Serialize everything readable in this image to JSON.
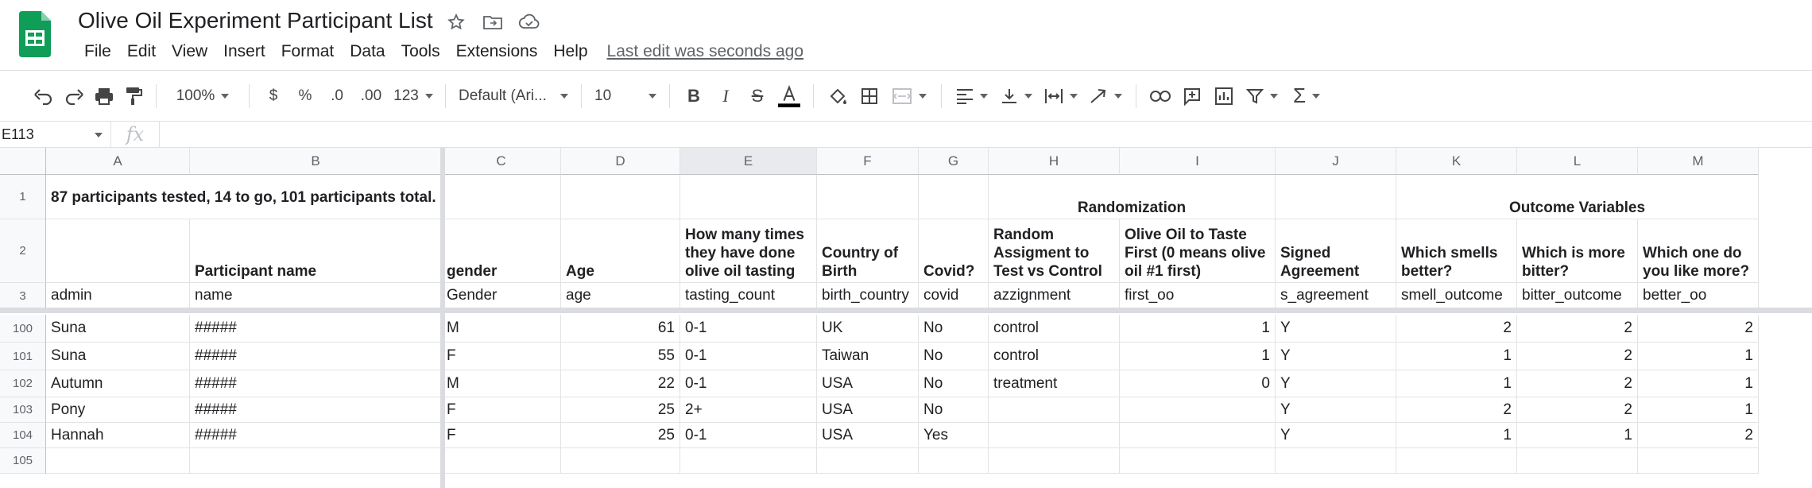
{
  "app": {
    "title": "Olive Oil Experiment Participant List",
    "menu": [
      "File",
      "Edit",
      "View",
      "Insert",
      "Format",
      "Data",
      "Tools",
      "Extensions",
      "Help"
    ],
    "last_edit": "Last edit was seconds ago"
  },
  "toolbar": {
    "zoom": "100%",
    "currency": "$",
    "percent": "%",
    "dec_decrease": ".0",
    "dec_increase": ".00",
    "more_formats": "123",
    "font": "Default (Ari...",
    "font_size": "10"
  },
  "formula_bar": {
    "cell_ref": "E113",
    "fx": "fx",
    "value": ""
  },
  "columns": [
    "A",
    "B",
    "C",
    "D",
    "E",
    "F",
    "G",
    "H",
    "I",
    "J",
    "K",
    "L",
    "M"
  ],
  "selected_column": "E",
  "row1": {
    "num": "1",
    "A": "87 participants tested, 14 to go, 101 participants total.",
    "H": "Randomization",
    "K": "Outcome Variables"
  },
  "row2": {
    "num": "2",
    "B": "Participant name",
    "C": "gender",
    "D": "Age",
    "E": "How many times they have done olive oil tasting",
    "F": "Country of Birth",
    "G": "Covid?",
    "H": "Random Assigment to Test vs Control",
    "I": "Olive Oil to Taste First (0 means olive oil #1 first)",
    "J": "Signed Agreement",
    "K": "Which smells better?",
    "L": "Which is more bitter?",
    "M": "Which one do you like more?"
  },
  "row3": {
    "num": "3",
    "A": "admin",
    "B": "name",
    "C": "Gender",
    "D": "age",
    "E": "tasting_count",
    "F": "birth_country",
    "G": "covid",
    "H": "azzignment",
    "I": "first_oo",
    "J": "s_agreement",
    "K": "smell_outcome",
    "L": "bitter_outcome",
    "M": "better_oo"
  },
  "data_rows": [
    {
      "num": "100",
      "A": "Suna",
      "B": "#####",
      "C": "M",
      "D": "61",
      "E": "0-1",
      "F": "UK",
      "G": "No",
      "H": "control",
      "I": "1",
      "J": "Y",
      "K": "2",
      "L": "2",
      "M": "2"
    },
    {
      "num": "101",
      "A": "Suna",
      "B": "#####",
      "C": "F",
      "D": "55",
      "E": "0-1",
      "F": "Taiwan",
      "G": "No",
      "H": "control",
      "I": "1",
      "J": "Y",
      "K": "1",
      "L": "2",
      "M": "1"
    },
    {
      "num": "102",
      "A": "Autumn",
      "B": "#####",
      "C": "M",
      "D": "22",
      "E": "0-1",
      "F": "USA",
      "G": "No",
      "H": "treatment",
      "I": "0",
      "J": "Y",
      "K": "1",
      "L": "2",
      "M": "1"
    },
    {
      "num": "103",
      "A": "Pony",
      "B": "#####",
      "C": "F",
      "D": "25",
      "E": "2+",
      "F": "USA",
      "G": "No",
      "H": "",
      "I": "",
      "J": "Y",
      "K": "2",
      "L": "2",
      "M": "1"
    },
    {
      "num": "104",
      "A": "Hannah",
      "B": "#####",
      "C": "F",
      "D": "25",
      "E": "0-1",
      "F": "USA",
      "G": "Yes",
      "H": "",
      "I": "",
      "J": "Y",
      "K": "1",
      "L": "1",
      "M": "2"
    },
    {
      "num": "105",
      "A": "",
      "B": "",
      "C": "",
      "D": "",
      "E": "",
      "F": "",
      "G": "",
      "H": "",
      "I": "",
      "J": "",
      "K": "",
      "L": "",
      "M": ""
    }
  ],
  "colors": {
    "sheets_green": "#0F9D58",
    "grid_line": "#e2e3e3",
    "header_bg": "#f8f9fa"
  }
}
